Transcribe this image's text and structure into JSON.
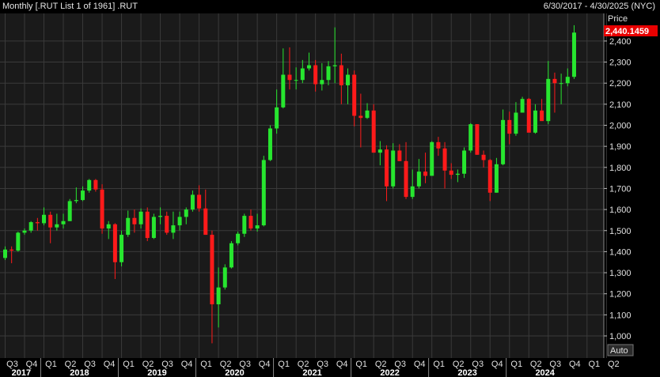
{
  "header": {
    "title": "Monthly [.RUT List 1 of 1961] .RUT",
    "date_range": "6/30/2017 - 4/30/2025 (NYC)"
  },
  "axis": {
    "price_label": "Price",
    "auto_label": "Auto",
    "last_price_label": "2,440.1459"
  },
  "colors": {
    "background": "#1a1a1a",
    "grid": "#3a3a3a",
    "up": "#27e62f",
    "down": "#ff1a1a",
    "last_price_badge": "#e80000"
  },
  "chart_data": {
    "type": "candlestick",
    "title": "",
    "ylim": [
      900,
      2500
    ],
    "y_ticks": [
      1000,
      1100,
      1200,
      1300,
      1400,
      1500,
      1600,
      1700,
      1800,
      1900,
      2000,
      2100,
      2200,
      2300,
      2400
    ],
    "y_tick_labels": [
      "1,000",
      "1,100",
      "1,200",
      "1,300",
      "1,400",
      "1,500",
      "1,600",
      "1,700",
      "1,800",
      "1,900",
      "2,000",
      "2,100",
      "2,200",
      "2,300",
      "2,400"
    ],
    "last_price": 2440.1459,
    "quarter_labels": [
      "Q3",
      "Q4",
      "Q1",
      "Q2",
      "Q3",
      "Q4",
      "Q1",
      "Q2",
      "Q3",
      "Q4",
      "Q1",
      "Q2",
      "Q3",
      "Q4",
      "Q1",
      "Q2",
      "Q3",
      "Q4",
      "Q1",
      "Q2",
      "Q3",
      "Q4",
      "Q1",
      "Q2",
      "Q3",
      "Q4",
      "Q1",
      "Q2",
      "Q3",
      "Q4",
      "Q1",
      "Q2"
    ],
    "years": [
      "2017",
      "2018",
      "2019",
      "2020",
      "2021",
      "2022",
      "2023",
      "2024"
    ],
    "months": [
      "2017-07",
      "2017-08",
      "2017-09",
      "2017-10",
      "2017-11",
      "2017-12",
      "2018-01",
      "2018-02",
      "2018-03",
      "2018-04",
      "2018-05",
      "2018-06",
      "2018-07",
      "2018-08",
      "2018-09",
      "2018-10",
      "2018-11",
      "2018-12",
      "2019-01",
      "2019-02",
      "2019-03",
      "2019-04",
      "2019-05",
      "2019-06",
      "2019-07",
      "2019-08",
      "2019-09",
      "2019-10",
      "2019-11",
      "2019-12",
      "2020-01",
      "2020-02",
      "2020-03",
      "2020-04",
      "2020-05",
      "2020-06",
      "2020-07",
      "2020-08",
      "2020-09",
      "2020-10",
      "2020-11",
      "2020-12",
      "2021-01",
      "2021-02",
      "2021-03",
      "2021-04",
      "2021-05",
      "2021-06",
      "2021-07",
      "2021-08",
      "2021-09",
      "2021-10",
      "2021-11",
      "2021-12",
      "2022-01",
      "2022-02",
      "2022-03",
      "2022-04",
      "2022-05",
      "2022-06",
      "2022-07",
      "2022-08",
      "2022-09",
      "2022-10",
      "2022-11",
      "2022-12",
      "2023-01",
      "2023-02",
      "2023-03",
      "2023-04",
      "2023-05",
      "2023-06",
      "2023-07",
      "2023-08",
      "2023-09",
      "2023-10",
      "2023-11",
      "2023-12",
      "2024-01",
      "2024-02",
      "2024-03",
      "2024-04",
      "2024-05",
      "2024-06",
      "2024-07",
      "2024-08",
      "2024-09",
      "2024-10",
      "2024-11"
    ],
    "open": [
      1370,
      1410,
      1405,
      1490,
      1500,
      1540,
      1535,
      1575,
      1515,
      1530,
      1545,
      1640,
      1645,
      1690,
      1740,
      1695,
      1510,
      1530,
      1350,
      1480,
      1560,
      1530,
      1590,
      1465,
      1565,
      1570,
      1490,
      1525,
      1565,
      1600,
      1670,
      1605,
      1480,
      1150,
      1230,
      1325,
      1440,
      1485,
      1570,
      1510,
      1525,
      1835,
      1985,
      2085,
      2240,
      2215,
      2215,
      2270,
      2285,
      2195,
      2215,
      2280,
      2285,
      2190,
      2240,
      2045,
      2035,
      2070,
      1870,
      1885,
      1710,
      1880,
      1830,
      1660,
      1710,
      1780,
      1760,
      1920,
      1890,
      1785,
      1765,
      1770,
      1880,
      2005,
      1860,
      1835,
      1680,
      1815,
      2025,
      1960,
      2060,
      2125,
      1965,
      2070,
      2020,
      2220,
      2200,
      2200,
      2230
    ],
    "close": [
      1410,
      1405,
      1490,
      1500,
      1540,
      1535,
      1575,
      1515,
      1530,
      1545,
      1640,
      1645,
      1690,
      1740,
      1695,
      1510,
      1530,
      1350,
      1480,
      1560,
      1530,
      1590,
      1465,
      1565,
      1570,
      1490,
      1525,
      1565,
      1600,
      1670,
      1605,
      1480,
      1150,
      1230,
      1325,
      1440,
      1485,
      1570,
      1510,
      1525,
      1835,
      1985,
      2085,
      2240,
      2215,
      2215,
      2270,
      2285,
      2195,
      2215,
      2280,
      2285,
      2190,
      2240,
      2045,
      2035,
      2070,
      1870,
      1885,
      1710,
      1880,
      1830,
      1660,
      1710,
      1780,
      1760,
      1920,
      1890,
      1785,
      1765,
      1770,
      1880,
      2005,
      1860,
      1835,
      1680,
      1815,
      2025,
      1960,
      2060,
      2125,
      1965,
      2070,
      2020,
      2220,
      2200,
      2200,
      2230,
      2440
    ],
    "high": [
      1425,
      1425,
      1495,
      1510,
      1545,
      1560,
      1610,
      1590,
      1580,
      1580,
      1650,
      1705,
      1710,
      1745,
      1745,
      1720,
      1545,
      1535,
      1500,
      1595,
      1600,
      1605,
      1610,
      1580,
      1610,
      1590,
      1590,
      1590,
      1610,
      1690,
      1715,
      1695,
      1500,
      1325,
      1340,
      1450,
      1495,
      1580,
      1600,
      1580,
      1855,
      2000,
      2170,
      2365,
      2370,
      2275,
      2310,
      2345,
      2310,
      2295,
      2305,
      2465,
      2340,
      2270,
      2260,
      2150,
      2105,
      2100,
      1925,
      1905,
      1915,
      1910,
      1920,
      1790,
      1840,
      1870,
      1925,
      1945,
      1920,
      1820,
      1790,
      1895,
      2010,
      2005,
      1880,
      1840,
      1845,
      2075,
      2065,
      2110,
      2135,
      2130,
      2100,
      2125,
      2305,
      2250,
      2245,
      2270,
      2475
    ],
    "low": [
      1360,
      1345,
      1400,
      1480,
      1490,
      1500,
      1525,
      1440,
      1500,
      1510,
      1545,
      1630,
      1640,
      1680,
      1685,
      1485,
      1460,
      1270,
      1330,
      1470,
      1490,
      1510,
      1450,
      1460,
      1530,
      1480,
      1460,
      1500,
      1530,
      1590,
      1590,
      1480,
      965,
      1040,
      1220,
      1320,
      1430,
      1470,
      1500,
      1495,
      1520,
      1830,
      1960,
      2080,
      2170,
      2170,
      2200,
      2260,
      2160,
      2165,
      2190,
      2200,
      2100,
      2100,
      1995,
      1895,
      2030,
      1870,
      1810,
      1640,
      1700,
      1830,
      1650,
      1650,
      1700,
      1725,
      1760,
      1855,
      1700,
      1745,
      1730,
      1750,
      1870,
      1860,
      1800,
      1640,
      1680,
      1810,
      1910,
      1950,
      2060,
      2000,
      1960,
      2030,
      2005,
      2060,
      2100,
      2185,
      2220
    ]
  }
}
